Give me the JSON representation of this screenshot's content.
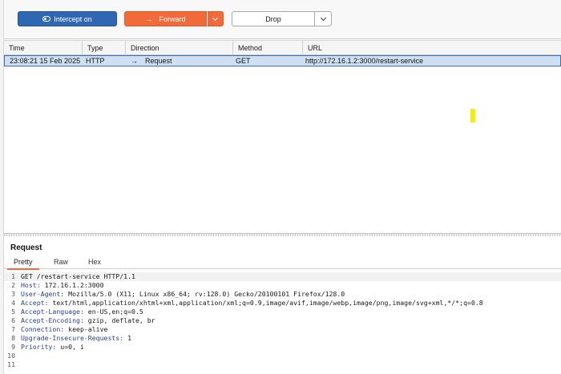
{
  "toolbar": {
    "intercept_label": "Intercept on",
    "forward_label": "Forward",
    "drop_label": "Drop"
  },
  "table": {
    "columns": [
      "Time",
      "Type",
      "Direction",
      "Method",
      "URL"
    ],
    "rows": [
      {
        "time": "23:08:21 15 Feb 2025",
        "type": "HTTP",
        "direction": "Request",
        "method": "GET",
        "url": "http://172.16.1.2:3000/restart-service"
      }
    ]
  },
  "request": {
    "title": "Request",
    "tabs": [
      "Pretty",
      "Raw",
      "Hex"
    ],
    "active_tab": "Pretty",
    "lines": [
      {
        "n": "1",
        "name": "",
        "value": "GET /restart-service HTTP/1.1"
      },
      {
        "n": "2",
        "name": "Host:",
        "value": " 172.16.1.2:3000"
      },
      {
        "n": "3",
        "name": "User-Agent:",
        "value": " Mozilla/5.0 (X11; Linux x86_64; rv:128.0) Gecko/20100101 Firefox/128.0"
      },
      {
        "n": "4",
        "name": "Accept:",
        "value": " text/html,application/xhtml+xml,application/xml;q=0.9,image/avif,image/webp,image/png,image/svg+xml,*/*;q=0.8"
      },
      {
        "n": "5",
        "name": "Accept-Language:",
        "value": " en-US,en;q=0.5"
      },
      {
        "n": "6",
        "name": "Accept-Encoding:",
        "value": " gzip, deflate, br"
      },
      {
        "n": "7",
        "name": "Connection:",
        "value": " keep-alive"
      },
      {
        "n": "8",
        "name": "Upgrade-Insecure-Requests:",
        "value": " 1"
      },
      {
        "n": "9",
        "name": "Priority:",
        "value": " u=0, i"
      },
      {
        "n": "10",
        "name": "",
        "value": ""
      },
      {
        "n": "11",
        "name": "",
        "value": ""
      }
    ]
  },
  "colors": {
    "intercept": "#2f67b2",
    "forward": "#f26a3a",
    "selection": "#cfe0f4",
    "header_name": "#2a3f8f",
    "cursor_highlight": "#f4ef00"
  }
}
